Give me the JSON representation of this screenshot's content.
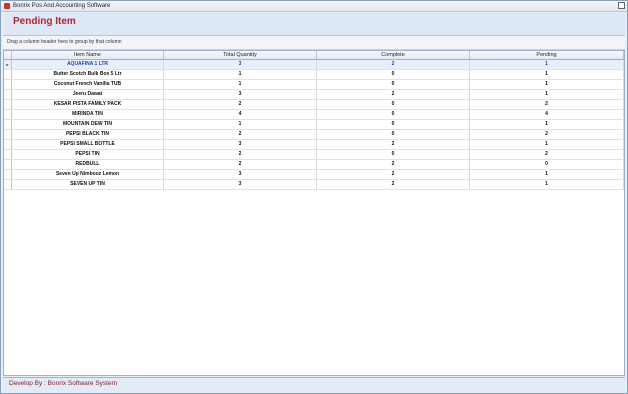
{
  "window": {
    "title": "Bonrix Pos And Accounting Software"
  },
  "header": {
    "title": "Pending Item"
  },
  "group_panel": {
    "hint": "Drag a column header here to group by that column"
  },
  "grid": {
    "columns": [
      "Item Name",
      "Total Quantity",
      "Complete",
      "Pending"
    ],
    "rows": [
      {
        "name": "AQUAFINA 1 LTR",
        "qty": "3",
        "complete": "2",
        "pending": "1",
        "selected": true
      },
      {
        "name": "Butter Scotch Bulk Box 5 Ltr",
        "qty": "1",
        "complete": "0",
        "pending": "1"
      },
      {
        "name": "Coconut French Vanilla TUB",
        "qty": "1",
        "complete": "0",
        "pending": "1"
      },
      {
        "name": "Jeeru Dawat",
        "qty": "3",
        "complete": "2",
        "pending": "1"
      },
      {
        "name": "KESAR PISTA FAMILY PACK",
        "qty": "2",
        "complete": "0",
        "pending": "2"
      },
      {
        "name": "MIRINDA TIN",
        "qty": "4",
        "complete": "0",
        "pending": "4"
      },
      {
        "name": "MOUNTAIN DEW TIN",
        "qty": "1",
        "complete": "0",
        "pending": "1"
      },
      {
        "name": "PEPSI BLACK TIN",
        "qty": "2",
        "complete": "0",
        "pending": "2"
      },
      {
        "name": "PEPSI SMALL BOTTLE",
        "qty": "3",
        "complete": "2",
        "pending": "1"
      },
      {
        "name": "PEPSI TIN",
        "qty": "2",
        "complete": "0",
        "pending": "2"
      },
      {
        "name": "REDBULL",
        "qty": "2",
        "complete": "2",
        "pending": "0"
      },
      {
        "name": "Seven Up Nimbooz Lemon",
        "qty": "3",
        "complete": "2",
        "pending": "1"
      },
      {
        "name": "SEVEN UP TIN",
        "qty": "3",
        "complete": "2",
        "pending": "1"
      }
    ],
    "current_row_indicator": "▸"
  },
  "footer": {
    "text": "Develop By : Bonrix Software System"
  },
  "colors": {
    "title_red": "#b32632",
    "selected_blue": "#1a3fd6"
  },
  "icons": {
    "app": "app-icon",
    "restore": "restore-icon"
  }
}
